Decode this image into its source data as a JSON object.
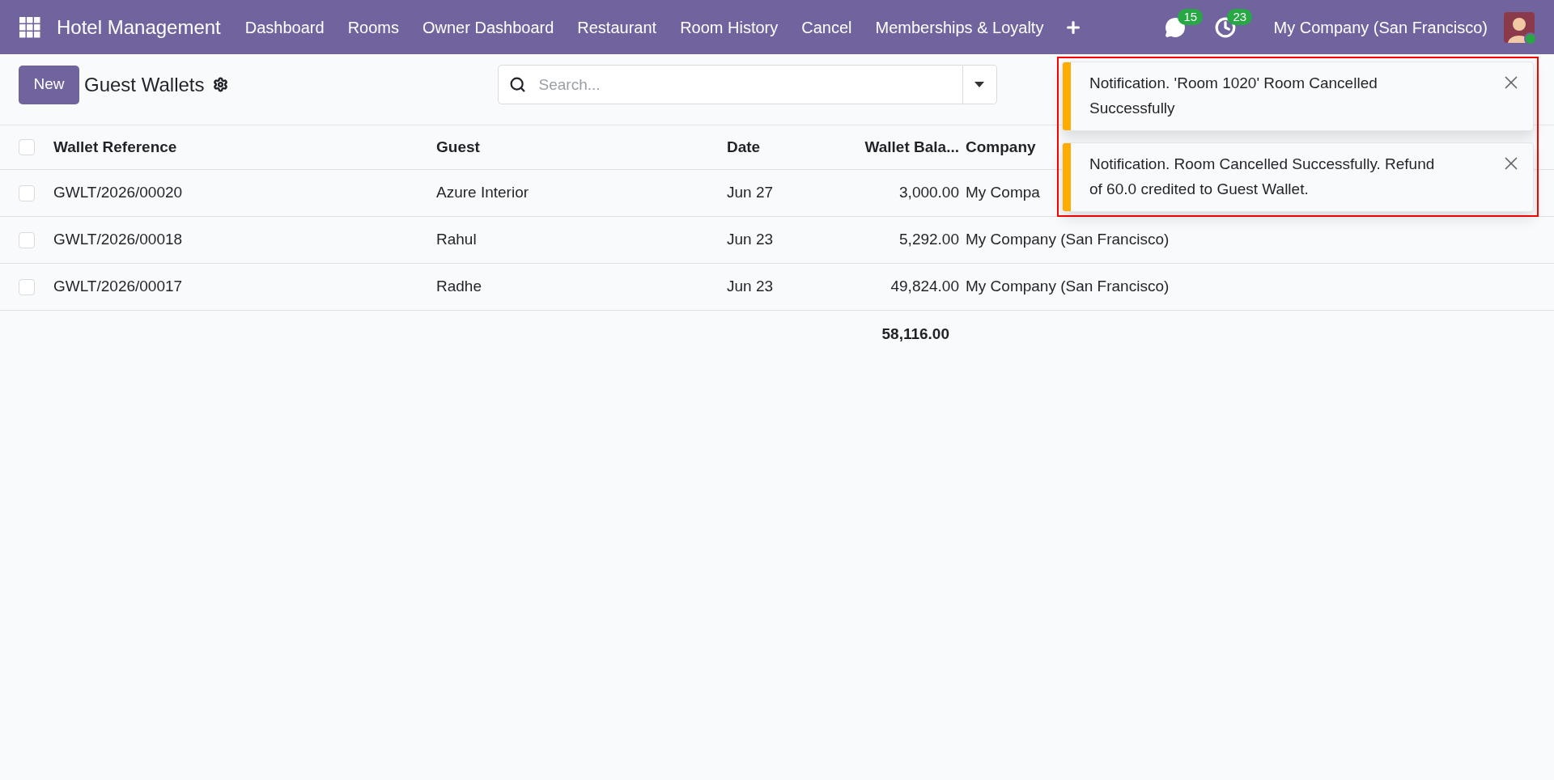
{
  "navbar": {
    "app_name": "Hotel Management",
    "menu": [
      "Dashboard",
      "Rooms",
      "Owner Dashboard",
      "Restaurant",
      "Room History",
      "Cancel",
      "Memberships & Loyalty"
    ],
    "messages_count": "15",
    "activities_count": "23",
    "company": "My Company (San Francisco)",
    "user_online": true
  },
  "control_panel": {
    "new_button": "New",
    "title": "Guest Wallets",
    "search": {
      "placeholder": "Search..."
    }
  },
  "table": {
    "select_all_checked": false,
    "columns": [
      {
        "label": "Wallet Reference"
      },
      {
        "label": "Guest"
      },
      {
        "label": "Date"
      },
      {
        "label": "Wallet Bala..."
      },
      {
        "label": "Company"
      }
    ],
    "rows": [
      {
        "checked": false,
        "cells": [
          "GWLT/2026/00020",
          "Azure Interior",
          "Jun 27",
          "3,000.00",
          "My Compa"
        ]
      },
      {
        "checked": false,
        "cells": [
          "GWLT/2026/00018",
          "Rahul",
          "Jun 23",
          "5,292.00",
          "My Company (San Francisco)"
        ]
      },
      {
        "checked": false,
        "cells": [
          "GWLT/2026/00017",
          "Radhe",
          "Jun 23",
          "49,824.00",
          "My Company (San Francisco)"
        ]
      }
    ],
    "total": "58,116.00"
  },
  "notifications": {
    "highlighted": true,
    "items": [
      {
        "message": "Notification. 'Room 1020' Room Cancelled Successfully",
        "color": "#ffac00"
      },
      {
        "message": "Notification. Room Cancelled Successfully. Refund of 60.0 credited to Guest Wallet.",
        "color": "#ffac00"
      }
    ]
  }
}
